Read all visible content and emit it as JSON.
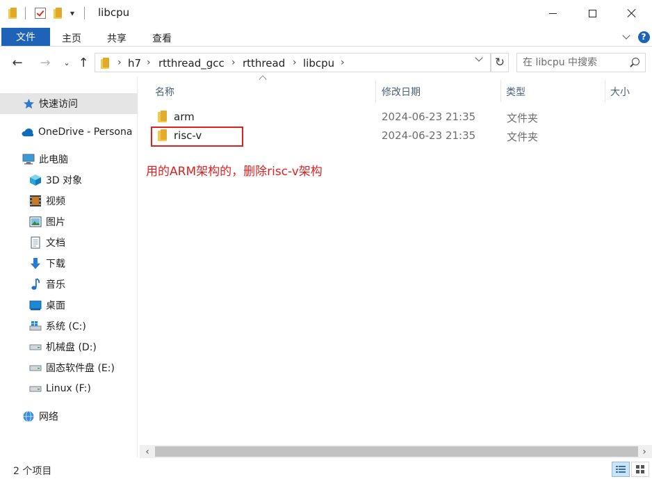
{
  "window": {
    "title": "libcpu",
    "quick_access_dropdown": "▾"
  },
  "ribbon": {
    "tabs": [
      "文件",
      "主页",
      "共享",
      "查看"
    ]
  },
  "address": {
    "crumbs": [
      "h7",
      "rtthread_gcc",
      "rtthread",
      "libcpu"
    ],
    "search_placeholder": "在 libcpu 中搜索"
  },
  "nav": {
    "items": [
      {
        "label": "快速访问",
        "icon": "star-icon"
      },
      {
        "label": "OneDrive - Persona",
        "icon": "cloud-icon"
      },
      {
        "label": "此电脑",
        "icon": "computer-icon"
      },
      {
        "label": "3D 对象",
        "icon": "cube-icon"
      },
      {
        "label": "视频",
        "icon": "film-icon"
      },
      {
        "label": "图片",
        "icon": "picture-icon"
      },
      {
        "label": "文档",
        "icon": "document-icon"
      },
      {
        "label": "下载",
        "icon": "download-icon"
      },
      {
        "label": "音乐",
        "icon": "music-icon"
      },
      {
        "label": "桌面",
        "icon": "desktop-icon"
      },
      {
        "label": "系统 (C:)",
        "icon": "windows-drive-icon"
      },
      {
        "label": "机械盘 (D:)",
        "icon": "drive-icon"
      },
      {
        "label": "固态软件盘 (E:)",
        "icon": "drive-icon"
      },
      {
        "label": "Linux (F:)",
        "icon": "drive-icon"
      },
      {
        "label": "网络",
        "icon": "network-icon"
      }
    ]
  },
  "columns": {
    "name": "名称",
    "date": "修改日期",
    "type": "类型",
    "size": "大小"
  },
  "files": [
    {
      "name": "arm",
      "date": "2024-06-23 21:35",
      "type": "文件夹"
    },
    {
      "name": "risc-v",
      "date": "2024-06-23 21:35",
      "type": "文件夹"
    }
  ],
  "annotation": "用的ARM架构的，删除risc-v架构",
  "status": {
    "item_count": "2 个项目"
  },
  "colors": {
    "accent": "#1e63b7",
    "annotation_red": "#e01f1f",
    "folder_yellow": "#f5c94a"
  }
}
